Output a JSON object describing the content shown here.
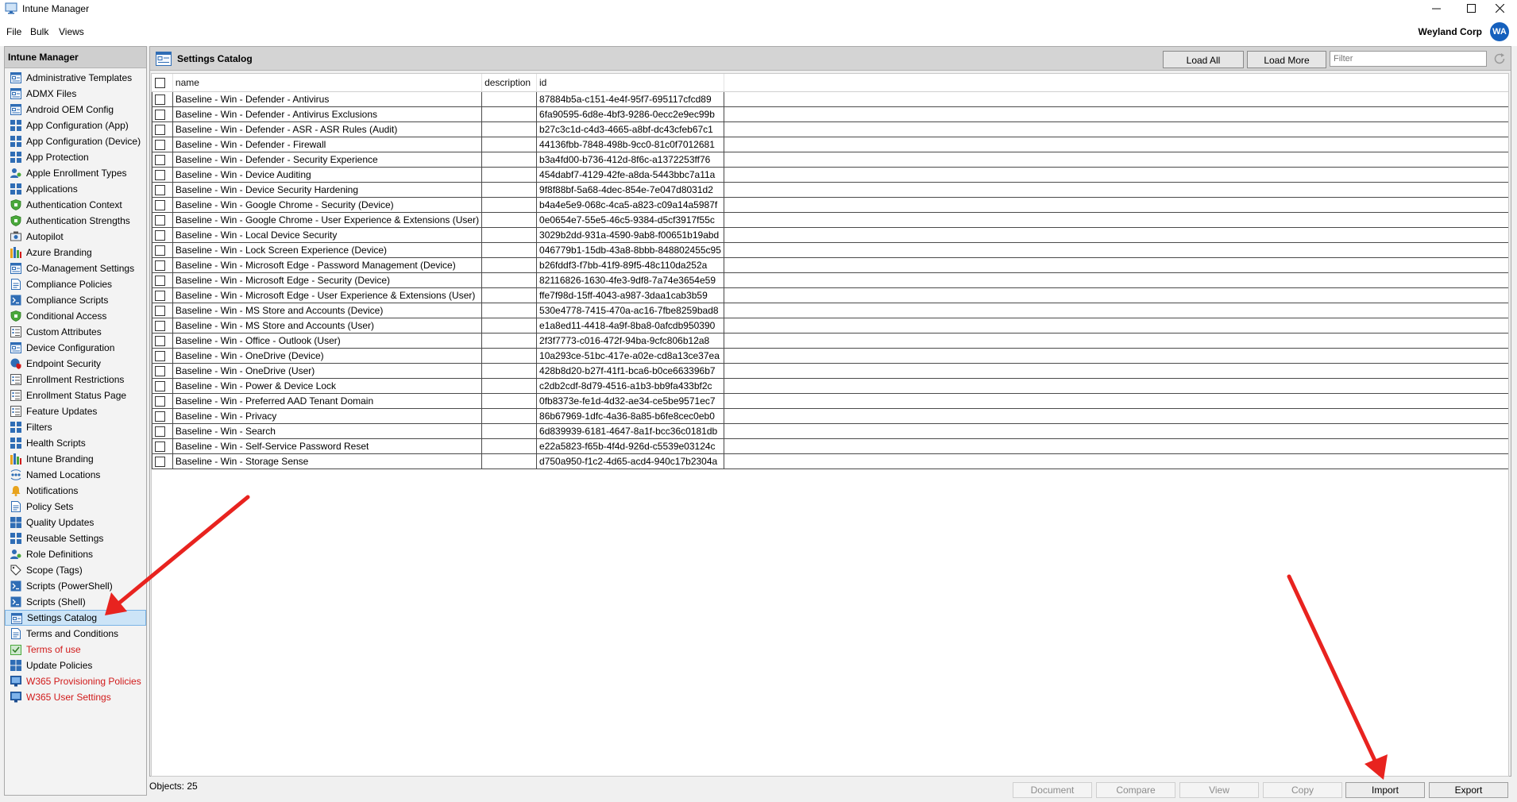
{
  "window": {
    "title": "Intune Manager"
  },
  "menu": {
    "items": [
      "File",
      "Bulk",
      "Views"
    ],
    "organization": "Weyland Corp",
    "avatar_initials": "WA"
  },
  "sidebar": {
    "header": "Intune Manager",
    "selected": "Settings Catalog",
    "items": [
      {
        "label": "Administrative Templates",
        "icon": "template-icon"
      },
      {
        "label": "ADMX Files",
        "icon": "template-icon"
      },
      {
        "label": "Android OEM Config",
        "icon": "template-icon"
      },
      {
        "label": "App Configuration (App)",
        "icon": "grid-icon"
      },
      {
        "label": "App Configuration (Device)",
        "icon": "grid-icon"
      },
      {
        "label": "App Protection",
        "icon": "grid-icon"
      },
      {
        "label": "Apple Enrollment Types",
        "icon": "person-icon"
      },
      {
        "label": "Applications",
        "icon": "grid-icon"
      },
      {
        "label": "Authentication Context",
        "icon": "shield-icon"
      },
      {
        "label": "Authentication Strengths",
        "icon": "shield-icon"
      },
      {
        "label": "Autopilot",
        "icon": "autopilot-icon"
      },
      {
        "label": "Azure Branding",
        "icon": "branding-icon"
      },
      {
        "label": "Co-Management Settings",
        "icon": "template-icon"
      },
      {
        "label": "Compliance Policies",
        "icon": "document-icon"
      },
      {
        "label": "Compliance Scripts",
        "icon": "script-icon"
      },
      {
        "label": "Conditional Access",
        "icon": "shield-icon"
      },
      {
        "label": "Custom Attributes",
        "icon": "list-icon"
      },
      {
        "label": "Device Configuration",
        "icon": "template-icon"
      },
      {
        "label": "Endpoint Security",
        "icon": "endpoint-security-icon"
      },
      {
        "label": "Enrollment Restrictions",
        "icon": "list-icon"
      },
      {
        "label": "Enrollment Status Page",
        "icon": "list-icon"
      },
      {
        "label": "Feature Updates",
        "icon": "list-icon"
      },
      {
        "label": "Filters",
        "icon": "grid-icon"
      },
      {
        "label": "Health Scripts",
        "icon": "grid-icon"
      },
      {
        "label": "Intune Branding",
        "icon": "branding-icon"
      },
      {
        "label": "Named Locations",
        "icon": "location-icon"
      },
      {
        "label": "Notifications",
        "icon": "bell-icon"
      },
      {
        "label": "Policy Sets",
        "icon": "document-icon"
      },
      {
        "label": "Quality Updates",
        "icon": "windows-icon"
      },
      {
        "label": "Reusable Settings",
        "icon": "grid-icon"
      },
      {
        "label": "Role Definitions",
        "icon": "person-icon"
      },
      {
        "label": "Scope (Tags)",
        "icon": "tag-icon"
      },
      {
        "label": "Scripts (PowerShell)",
        "icon": "script-icon"
      },
      {
        "label": "Scripts (Shell)",
        "icon": "script-icon"
      },
      {
        "label": "Settings Catalog",
        "icon": "template-icon"
      },
      {
        "label": "Terms and Conditions",
        "icon": "document-icon"
      },
      {
        "label": "Terms of use",
        "icon": "terms-icon",
        "color": "#d11a1a"
      },
      {
        "label": "Update Policies",
        "icon": "windows-icon"
      },
      {
        "label": "W365 Provisioning Policies",
        "icon": "w365-icon",
        "color": "#d11a1a"
      },
      {
        "label": "W365 User Settings",
        "icon": "w365-icon",
        "color": "#d11a1a"
      }
    ]
  },
  "panel": {
    "title": "Settings Catalog",
    "load_all": "Load All",
    "load_more": "Load More",
    "filter_placeholder": "Filter"
  },
  "grid": {
    "columns": [
      "name",
      "description",
      "id"
    ],
    "rows": [
      {
        "name": "Baseline - Win - Defender - Antivirus",
        "description": "",
        "id": "87884b5a-c151-4e4f-95f7-695117cfcd89"
      },
      {
        "name": "Baseline - Win - Defender - Antivirus Exclusions",
        "description": "",
        "id": "6fa90595-6d8e-4bf3-9286-0ecc2e9ec99b"
      },
      {
        "name": "Baseline - Win - Defender - ASR - ASR Rules (Audit)",
        "description": "",
        "id": "b27c3c1d-c4d3-4665-a8bf-dc43cfeb67c1"
      },
      {
        "name": "Baseline - Win - Defender - Firewall",
        "description": "",
        "id": "44136fbb-7848-498b-9cc0-81c0f7012681"
      },
      {
        "name": "Baseline - Win - Defender - Security Experience",
        "description": "",
        "id": "b3a4fd00-b736-412d-8f6c-a1372253ff76"
      },
      {
        "name": "Baseline - Win - Device Auditing",
        "description": "",
        "id": "454dabf7-4129-42fe-a8da-5443bbc7a11a"
      },
      {
        "name": "Baseline - Win - Device Security Hardening",
        "description": "",
        "id": "9f8f88bf-5a68-4dec-854e-7e047d8031d2"
      },
      {
        "name": "Baseline - Win - Google Chrome - Security (Device)",
        "description": "",
        "id": "b4a4e5e9-068c-4ca5-a823-c09a14a5987f"
      },
      {
        "name": "Baseline - Win - Google Chrome - User Experience & Extensions (User)",
        "description": "",
        "id": "0e0654e7-55e5-46c5-9384-d5cf3917f55c"
      },
      {
        "name": "Baseline - Win - Local Device Security",
        "description": "",
        "id": "3029b2dd-931a-4590-9ab8-f00651b19abd"
      },
      {
        "name": "Baseline - Win - Lock Screen Experience (Device)",
        "description": "",
        "id": "046779b1-15db-43a8-8bbb-848802455c95"
      },
      {
        "name": "Baseline - Win - Microsoft Edge - Password Management (Device)",
        "description": "",
        "id": "b26fddf3-f7bb-41f9-89f5-48c110da252a"
      },
      {
        "name": "Baseline - Win - Microsoft Edge - Security (Device)",
        "description": "",
        "id": "82116826-1630-4fe3-9df8-7a74e3654e59"
      },
      {
        "name": "Baseline - Win - Microsoft Edge - User Experience & Extensions (User)",
        "description": "",
        "id": "ffe7f98d-15ff-4043-a987-3daa1cab3b59"
      },
      {
        "name": "Baseline - Win - MS Store and Accounts (Device)",
        "description": "",
        "id": "530e4778-7415-470a-ac16-7fbe8259bad8"
      },
      {
        "name": "Baseline - Win - MS Store and Accounts (User)",
        "description": "",
        "id": "e1a8ed11-4418-4a9f-8ba8-0afcdb950390"
      },
      {
        "name": "Baseline - Win - Office - Outlook (User)",
        "description": "",
        "id": "2f3f7773-c016-472f-94ba-9cfc806b12a8"
      },
      {
        "name": "Baseline - Win - OneDrive (Device)",
        "description": "",
        "id": "10a293ce-51bc-417e-a02e-cd8a13ce37ea"
      },
      {
        "name": "Baseline - Win - OneDrive (User)",
        "description": "",
        "id": "428b8d20-b27f-41f1-bca6-b0ce663396b7"
      },
      {
        "name": "Baseline - Win - Power & Device Lock",
        "description": "",
        "id": "c2db2cdf-8d79-4516-a1b3-bb9fa433bf2c"
      },
      {
        "name": "Baseline - Win - Preferred AAD Tenant Domain",
        "description": "",
        "id": "0fb8373e-fe1d-4d32-ae34-ce5be9571ec7"
      },
      {
        "name": "Baseline - Win - Privacy",
        "description": "",
        "id": "86b67969-1dfc-4a36-8a85-b6fe8cec0eb0"
      },
      {
        "name": "Baseline - Win - Search",
        "description": "",
        "id": "6d839939-6181-4647-8a1f-bcc36c0181db"
      },
      {
        "name": "Baseline - Win - Self-Service Password Reset",
        "description": "",
        "id": "e22a5823-f65b-4f4d-926d-c5539e03124c"
      },
      {
        "name": "Baseline - Win - Storage Sense",
        "description": "",
        "id": "d750a950-f1c2-4d65-acd4-940c17b2304a"
      }
    ]
  },
  "status": {
    "objects": "Objects: 25"
  },
  "actions": {
    "document": "Document",
    "compare": "Compare",
    "view": "View",
    "copy": "Copy",
    "import": "Import",
    "export": "Export"
  },
  "colors": {
    "accent": "#1560bd",
    "selection": "#cce4f7",
    "warning_text": "#d11a1a",
    "annotation_arrow": "#e8231f"
  }
}
